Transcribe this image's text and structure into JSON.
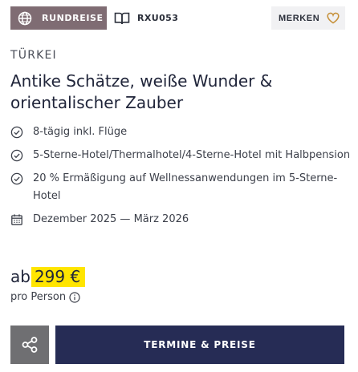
{
  "header": {
    "badge_label": "RUNDREISE",
    "badge_icon": "globe-icon",
    "badge_color": "#7f6c73",
    "code_label": "RXU053",
    "code_icon": "book-icon",
    "merken_label": "MERKEN",
    "merken_icon": "heart-icon"
  },
  "trip": {
    "country": "TÜRKEI",
    "title": "Antike Schätze, weiße Wunder & orientalischer Zauber",
    "features": [
      {
        "icon": "check-circle-icon",
        "text": "8-tägig inkl. Flüge"
      },
      {
        "icon": "check-circle-icon",
        "text": "5-Sterne-Hotel/Thermalhotel/4-Sterne-Hotel mit Halbpension"
      },
      {
        "icon": "check-circle-icon",
        "text": "20 % Ermäßigung auf Wellnessanwendungen im 5-Sterne-Hotel"
      },
      {
        "icon": "calendar-icon",
        "text": "Dezember 2025 — März 2026"
      }
    ]
  },
  "price": {
    "prefix": "ab",
    "value": "299 €",
    "highlight_color": "#ffe500",
    "per_person": "pro Person",
    "info_icon": "info-icon"
  },
  "actions": {
    "share_icon": "share-icon",
    "cta_label": "TERMINE & PREISE",
    "cta_color": "#262c55"
  }
}
